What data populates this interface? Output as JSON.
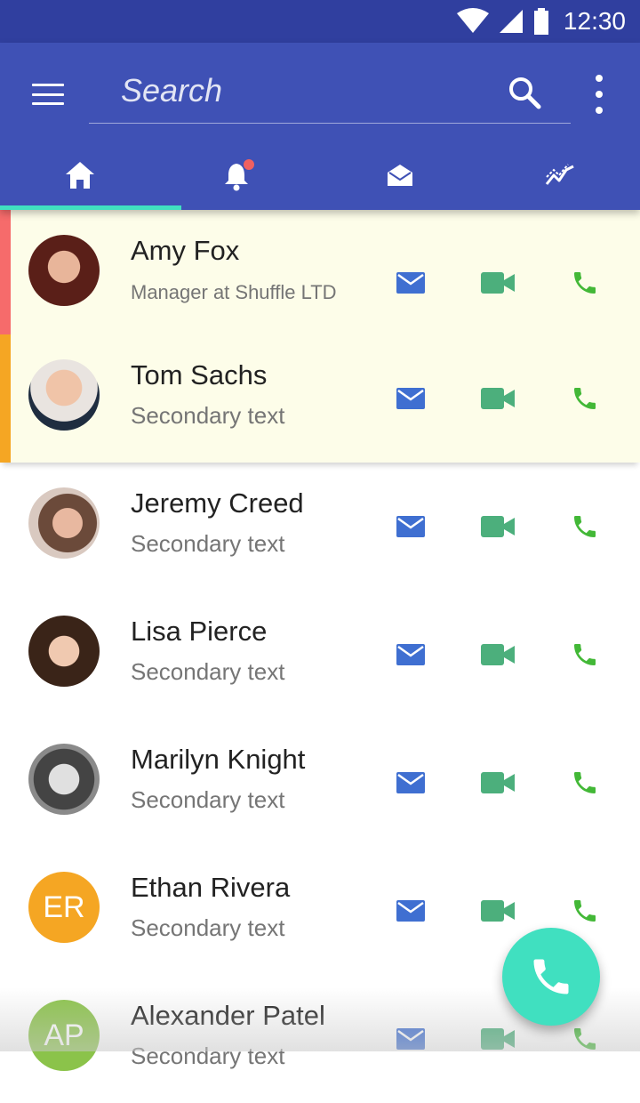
{
  "status_bar": {
    "time": "12:30"
  },
  "search": {
    "placeholder": "Search",
    "value": ""
  },
  "tabs": [
    {
      "icon": "home-icon",
      "active": true
    },
    {
      "icon": "notification-bell-icon",
      "badge": true
    },
    {
      "icon": "mail-open-icon"
    },
    {
      "icon": "trending-icon"
    }
  ],
  "colors": {
    "primary": "#3f51b5",
    "primary_dark": "#303f9f",
    "accent": "#40e0c0",
    "mail": "#3f6fd1",
    "video": "#4caf7c",
    "phone": "#43b837",
    "highlight": "#fdfde9"
  },
  "contacts": [
    {
      "name": "Amy Fox",
      "subtitle": "Manager at Shuffle LTD",
      "avatar": "photo",
      "stripe": "#f66b6b",
      "highlight": true
    },
    {
      "name": "Tom Sachs",
      "subtitle": "Secondary text",
      "avatar": "photo",
      "stripe": "#f5a623",
      "highlight": true
    },
    {
      "name": "Jeremy Creed",
      "subtitle": "Secondary text",
      "avatar": "photo"
    },
    {
      "name": "Lisa Pierce",
      "subtitle": "Secondary text",
      "avatar": "photo"
    },
    {
      "name": "Marilyn Knight",
      "subtitle": "Secondary text",
      "avatar": "photo"
    },
    {
      "name": "Ethan Rivera",
      "subtitle": "Secondary text",
      "avatar_initials": "ER",
      "avatar_color": "#f5a623"
    },
    {
      "name": "Alexander Patel",
      "subtitle": "Secondary text",
      "avatar_initials": "AP",
      "avatar_color": "#8bc34a"
    }
  ]
}
